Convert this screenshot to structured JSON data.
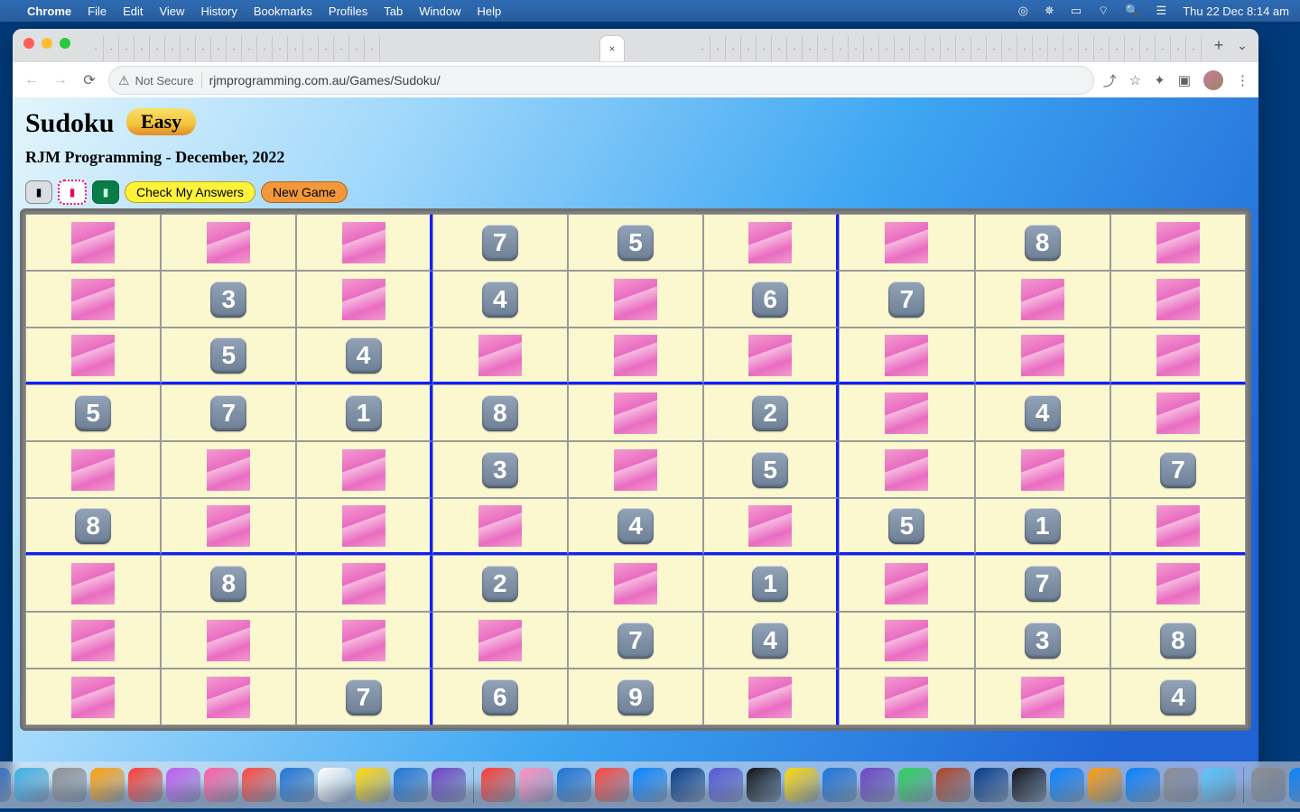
{
  "menubar": {
    "app": "Chrome",
    "items": [
      "File",
      "Edit",
      "View",
      "History",
      "Bookmarks",
      "Profiles",
      "Tab",
      "Window",
      "Help"
    ],
    "clock": "Thu 22 Dec  8:14 am"
  },
  "browser": {
    "security_label": "Not Secure",
    "url": "rjmprogramming.com.au/Games/Sudoku/",
    "tab_count_before": 19,
    "tab_count_after": 47
  },
  "page": {
    "title": "Sudoku",
    "difficulty": "Easy",
    "subtitle": "RJM Programming - December, 2022",
    "btn_check": "Check My Answers",
    "btn_new": "New Game"
  },
  "sudoku": {
    "grid": [
      [
        null,
        null,
        null,
        "7",
        "5",
        null,
        null,
        "8",
        null
      ],
      [
        null,
        "3",
        null,
        "4",
        null,
        "6",
        "7",
        null,
        null
      ],
      [
        null,
        "5",
        "4",
        null,
        null,
        null,
        null,
        null,
        null
      ],
      [
        "5",
        "7",
        "1",
        "8",
        null,
        "2",
        null,
        "4",
        null
      ],
      [
        null,
        null,
        null,
        "3",
        null,
        "5",
        null,
        null,
        "7"
      ],
      [
        "8",
        null,
        null,
        null,
        "4",
        null,
        "5",
        "1",
        null
      ],
      [
        null,
        "8",
        null,
        "2",
        null,
        "1",
        null,
        "7",
        null
      ],
      [
        null,
        null,
        null,
        null,
        "7",
        "4",
        null,
        "3",
        "8"
      ],
      [
        null,
        null,
        "7",
        "6",
        "9",
        null,
        null,
        null,
        "4"
      ]
    ]
  },
  "dock_colors": [
    "#2b6fd6",
    "#3cb0e8",
    "#8e8e93",
    "#ff9f0a",
    "#ff3b30",
    "#bf5af2",
    "#ff5ca0",
    "#ff453a",
    "#1e73d6",
    "#ffffff",
    "#ffd60a",
    "#1e73d6",
    "#6f42c1",
    "#ff3b30",
    "#ff8fc0",
    "#1e73d6",
    "#ff453a",
    "#0a84ff",
    "#0a3b84",
    "#5856d6",
    "#111111",
    "#ffd60a",
    "#1e73d6",
    "#6f42c1",
    "#30d158",
    "#b04524",
    "#0a3b84",
    "#111111",
    "#0a84ff",
    "#ff9f0a",
    "#0a84ff",
    "#8e8e93",
    "#5ac8fa",
    "#8e8e93",
    "#0a84ff"
  ]
}
